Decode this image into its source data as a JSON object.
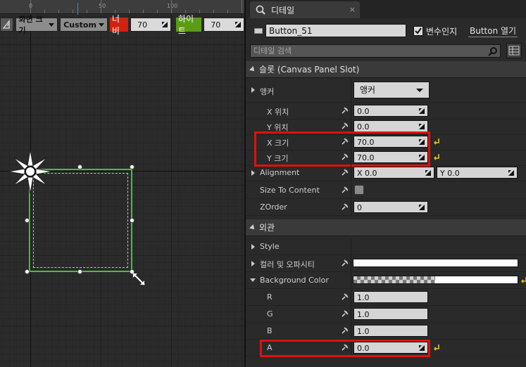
{
  "designer": {
    "ruler_labels": [
      "0",
      "50",
      "100"
    ],
    "toolbar": {
      "screen_size_label": "화면 크기",
      "preset_label": "Custom",
      "width_label": "너비",
      "width_value": "70",
      "height_label": "하이트",
      "height_value": "70"
    },
    "colors": {
      "width_badge": "#d0220e",
      "height_badge": "#5b9c17",
      "selection": "#38c838"
    }
  },
  "details": {
    "tab_title": "디테일",
    "tab_close": "×",
    "widget_name": "Button_51",
    "is_variable_label": "변수인지",
    "open_button_label": "Button 열기",
    "search_placeholder": "디테일 검색",
    "slot_category": "슬롯 (Canvas Panel Slot)",
    "anchor_label": "앵커",
    "anchor_value": "앵커",
    "x_pos_label": "X 위치",
    "x_pos_value": "0.0",
    "y_pos_label": "Y 위치",
    "y_pos_value": "0.0",
    "x_size_label": "X 크기",
    "x_size_value": "70.0",
    "y_size_label": "Y 크기",
    "y_size_value": "70.0",
    "alignment_label": "Alignment",
    "alignment_x": "X  0.0",
    "alignment_y": "Y  0.0",
    "size_to_content_label": "Size To Content",
    "zorder_label": "ZOrder",
    "zorder_value": "0",
    "appearance_category": "외관",
    "style_label": "Style",
    "color_opacity_label": "컬러 및 오파시티",
    "bg_color_label": "Background Color",
    "r_label": "R",
    "r_value": "1.0",
    "g_label": "G",
    "g_value": "1.0",
    "b_label": "B",
    "b_value": "1.0",
    "a_label": "A",
    "a_value": "0.0"
  },
  "highlight_color": "#e01010"
}
